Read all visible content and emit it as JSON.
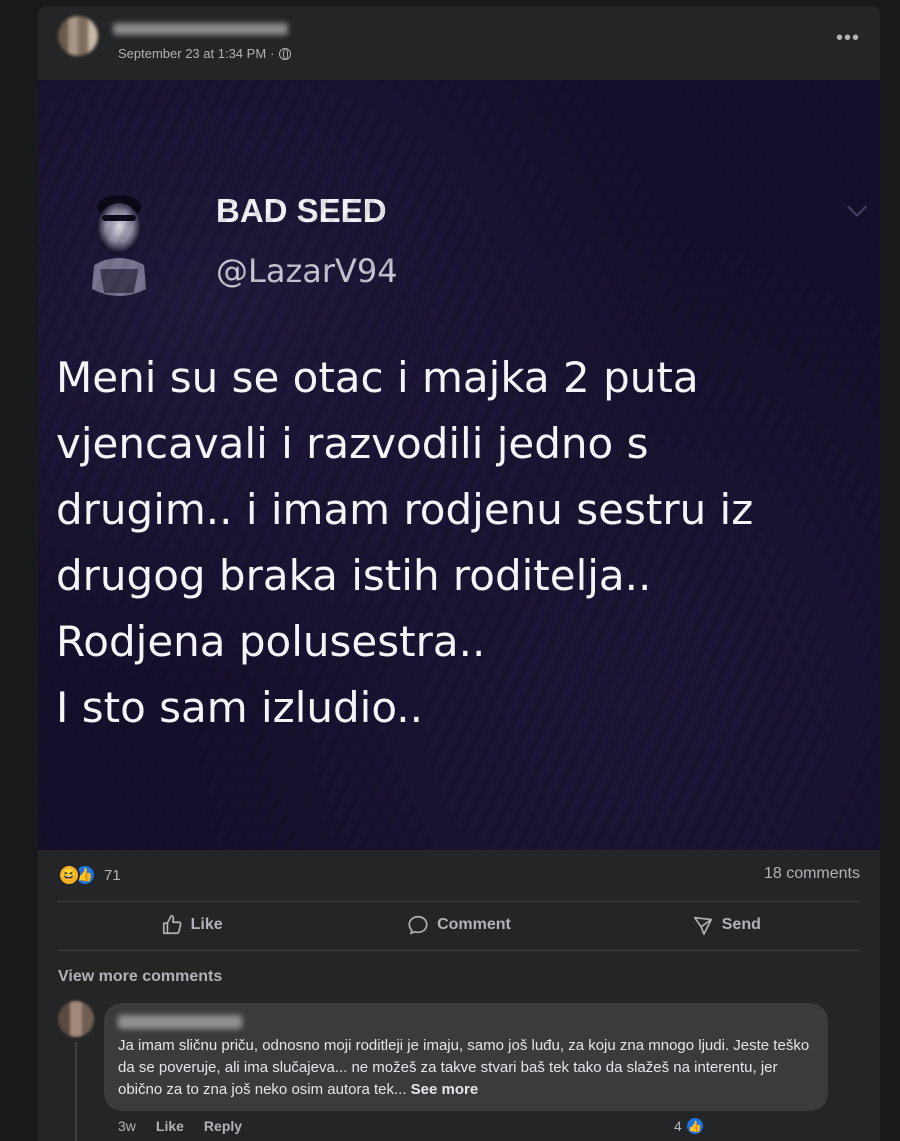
{
  "post": {
    "timestamp": "September 23 at 1:34 PM",
    "separator": "·",
    "more_label": "•••"
  },
  "tweet": {
    "display_name": "BAD SEED",
    "handle": "@LazarV94",
    "lines": [
      "Meni su se otac i majka 2 puta",
      "vjencavali i razvodili jedno s",
      "drugim.. i imam rodjenu sestru iz",
      "drugog braka istih roditelja..",
      "Rodjena polusestra..",
      "I sto sam izludio.."
    ]
  },
  "stats": {
    "reaction_count": "71",
    "comment_count": "18 comments",
    "haha_icon": "😆",
    "like_icon": "👍"
  },
  "actions": {
    "like": "Like",
    "comment": "Comment",
    "send": "Send"
  },
  "comments": {
    "view_more": "View more comments",
    "first": {
      "text": "Ja imam sličnu priču, odnosno moji roditleji je imaju, samo još luđu, za koju zna mnogo ljudi. Jeste teško da se poveruje, ali ima slučajeva... ne možeš za takve stvari baš tek tako da slažeš na interentu, jer obično za to zna još neko osim autora tek...",
      "see_more": "See more",
      "age": "3w",
      "like": "Like",
      "reply": "Reply",
      "reaction_count": "4"
    }
  },
  "colors": {
    "background": "#18191a",
    "card": "#242526",
    "bubble": "#3a3b3c",
    "tweet_bg": "#150f2c",
    "like_blue": "#1b74e4",
    "haha_yellow": "#f7b125"
  }
}
